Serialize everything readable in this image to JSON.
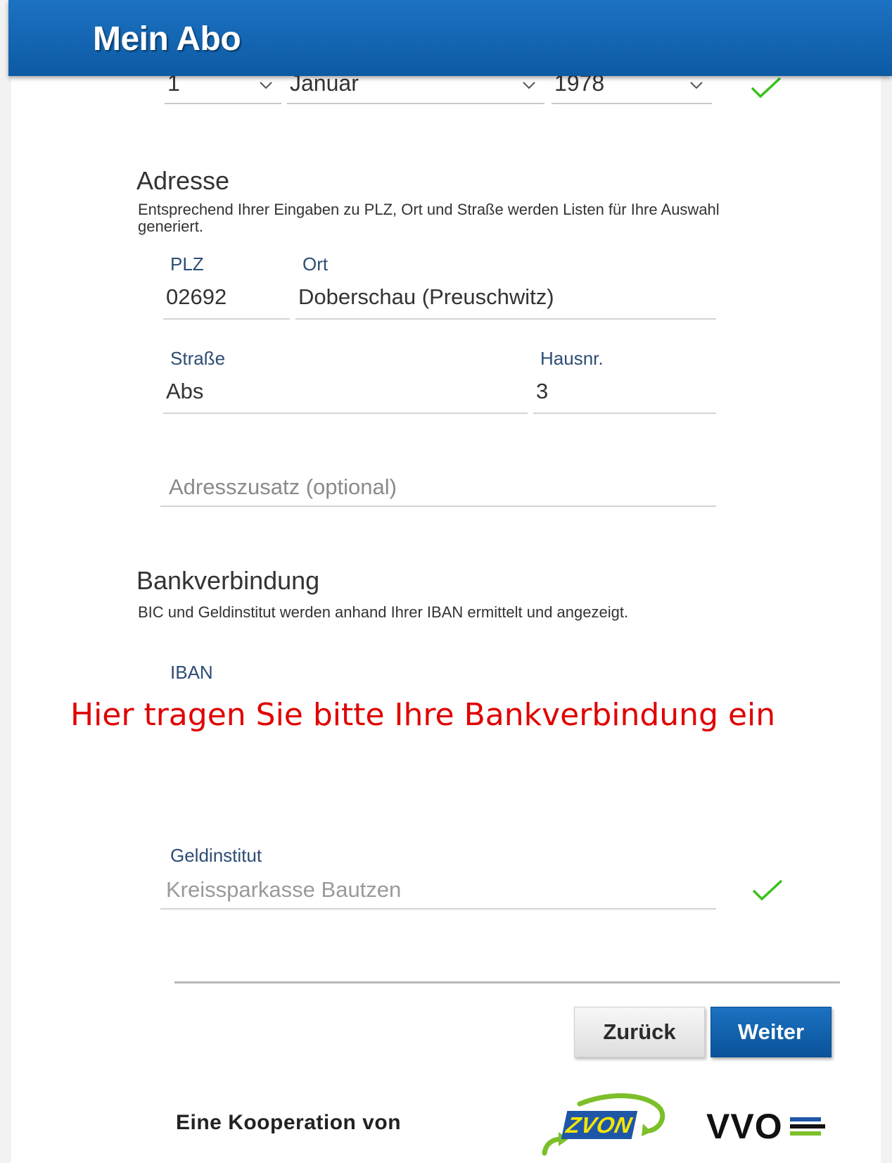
{
  "app_bar": {
    "title": "Mein Abo"
  },
  "birthdate": {
    "day": "1",
    "month": "Januar",
    "year": "1978"
  },
  "address": {
    "title": "Adresse",
    "description": "Entsprechend Ihrer Eingaben zu PLZ, Ort und Straße werden Listen für Ihre Auswahl generiert.",
    "plz_label": "PLZ",
    "plz_value": "02692",
    "ort_label": "Ort",
    "ort_value": "Doberschau (Preuschwitz)",
    "street_label": "Straße",
    "street_value": "Abs",
    "house_label": "Hausnr.",
    "house_value": "3",
    "extra_placeholder": "Adresszusatz (optional)"
  },
  "bank": {
    "title": "Bankverbindung",
    "description": "BIC und Geldinstitut werden anhand Ihrer IBAN ermittelt und angezeigt.",
    "iban_label": "IBAN",
    "institute_label": "Geldinstitut",
    "institute_value": "Kreissparkasse Bautzen"
  },
  "annotation": "Hier tragen Sie bitte Ihre Bankverbindung ein",
  "buttons": {
    "back": "Zurück",
    "next": "Weiter"
  },
  "footer": {
    "cooperation": "Eine Kooperation von",
    "logo_zvon": "ZVON",
    "logo_vvo": "VVO"
  },
  "colors": {
    "brand_blue": "#0d5aa4",
    "check_green": "#38c21c",
    "annotation_red": "#e00000"
  }
}
